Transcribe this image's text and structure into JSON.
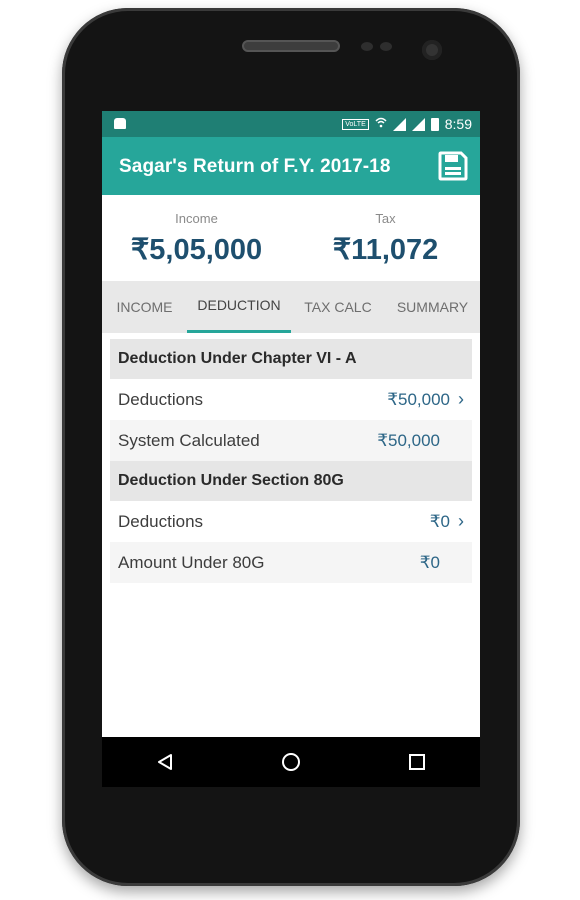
{
  "status_bar": {
    "volte": "VoLTE",
    "time": "8:59",
    "icons": [
      "android-notification-icon",
      "volte-icon",
      "wifi-calling-icon",
      "signal-icon",
      "signal-icon",
      "battery-icon"
    ]
  },
  "app_bar": {
    "title": "Sagar's Return of F.Y. 2017-18",
    "action_icon": "save-icon",
    "color": "#26a69a"
  },
  "summary": {
    "income_label": "Income",
    "income_value": "₹5,05,000",
    "tax_label": "Tax",
    "tax_value": "₹11,072"
  },
  "tabs": [
    {
      "label": "INCOME",
      "active": false
    },
    {
      "label": "DEDUCTION",
      "active": true
    },
    {
      "label": "TAX CALC",
      "active": false
    },
    {
      "label": "SUMMARY",
      "active": false
    }
  ],
  "sections": [
    {
      "title": "Deduction Under Chapter VI - A",
      "rows": [
        {
          "label": "Deductions",
          "value": "₹50,000",
          "has_chevron": true
        },
        {
          "label": "System Calculated",
          "value": "₹50,000",
          "has_chevron": false
        }
      ]
    },
    {
      "title": "Deduction Under Section 80G",
      "rows": [
        {
          "label": "Deductions",
          "value": "₹0",
          "has_chevron": true
        },
        {
          "label": "Amount Under 80G",
          "value": "₹0",
          "has_chevron": false
        }
      ]
    }
  ],
  "nav_bar": {
    "icons": [
      "back-icon",
      "home-icon",
      "recents-icon"
    ]
  },
  "colors": {
    "primary": "#26a69a",
    "primary_dark": "#1f7f74",
    "value_blue": "#1e4f6e"
  }
}
